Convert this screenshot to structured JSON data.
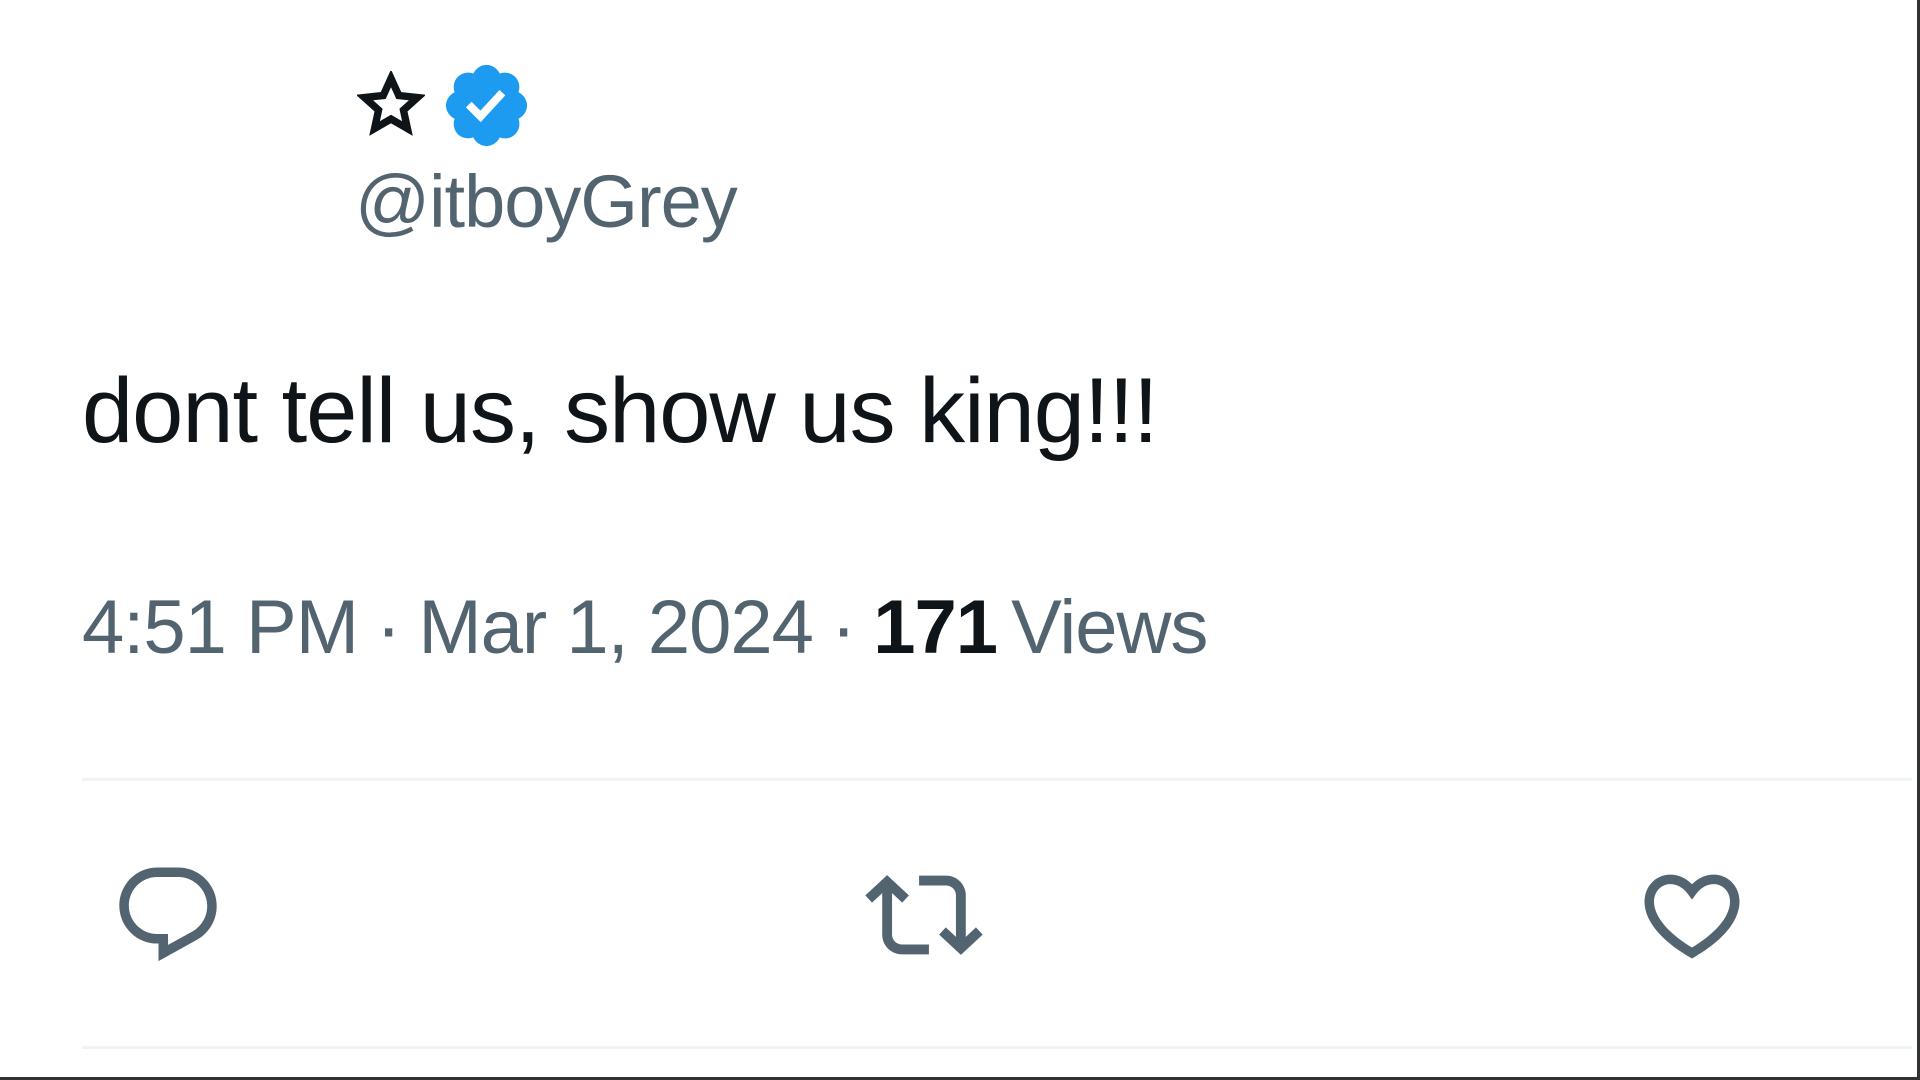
{
  "tweet": {
    "display_name_emoji": "☆",
    "verified": true,
    "handle": "@itboyGrey",
    "text": "dont tell us, show us king!!!",
    "time": "4:51 PM",
    "separator": "·",
    "date": "Mar 1, 2024",
    "views_count": "171",
    "views_label": "Views"
  },
  "actions": [
    {
      "icon": "reply-icon"
    },
    {
      "icon": "retweet-icon"
    },
    {
      "icon": "like-icon"
    }
  ],
  "colors": {
    "text_primary": "#0f1419",
    "text_secondary": "#536471",
    "verified_blue": "#1d9bf0",
    "divider": "#eff3f4"
  }
}
